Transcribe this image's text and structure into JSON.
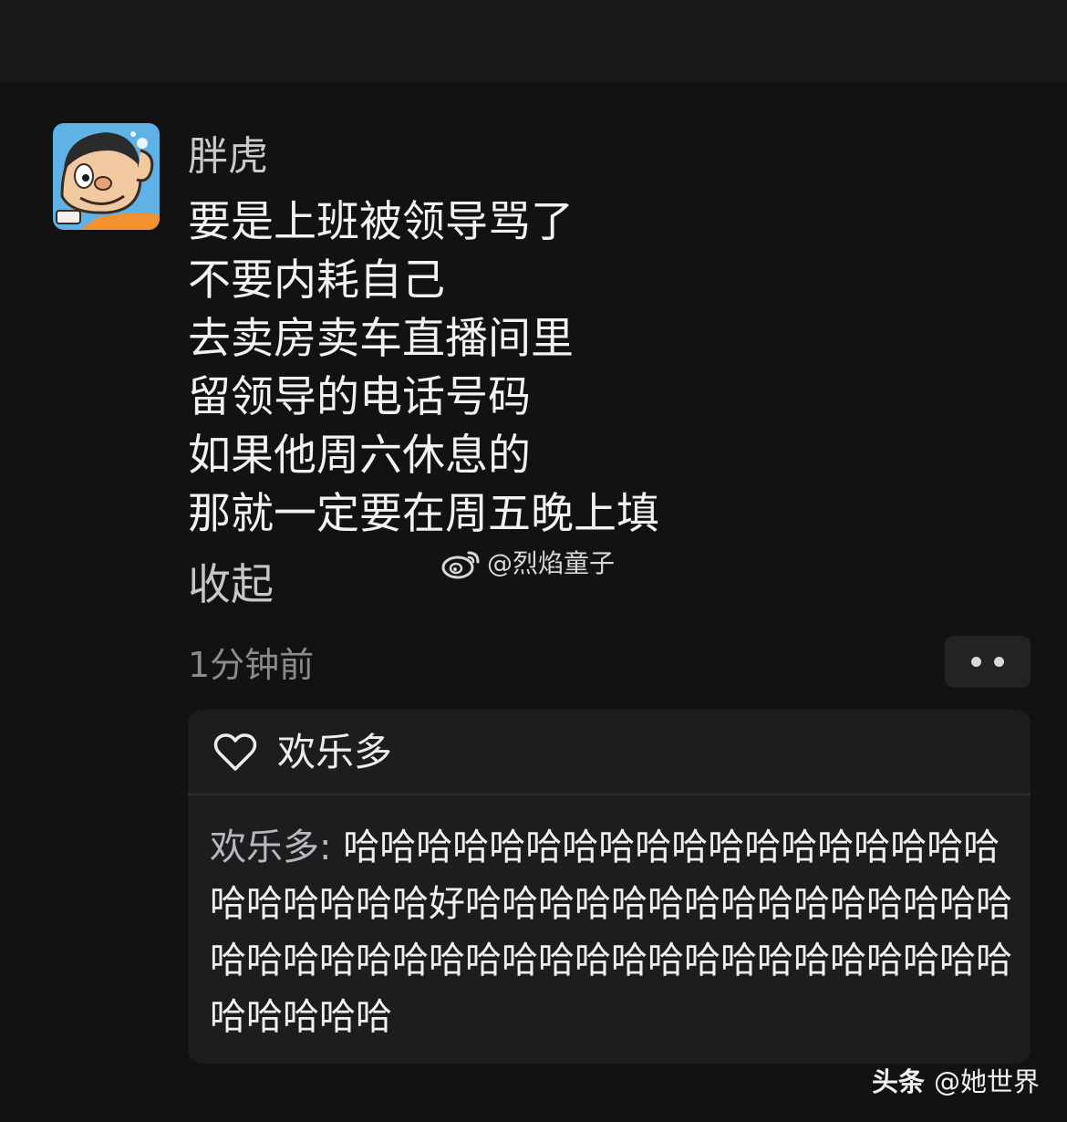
{
  "post": {
    "username": "胖虎",
    "lines": [
      "要是上班被领导骂了",
      "不要内耗自己",
      "去卖房卖车直播间里",
      "留领导的电话号码",
      "如果他周六休息的",
      "那就一定要在周五晚上填"
    ],
    "collapse_label": "收起",
    "timestamp": "1分钟前"
  },
  "reply": {
    "liker": "欢乐多",
    "author": "欢乐多:",
    "text": " 哈哈哈哈哈哈哈哈哈哈哈哈哈哈哈哈哈哈哈哈哈哈哈哈好哈哈哈哈哈哈哈哈哈哈哈哈哈哈哈哈哈哈哈哈哈哈哈哈哈哈哈哈哈哈哈哈哈哈哈哈哈哈哈哈哈哈"
  },
  "watermarks": {
    "weibo": "@烈焰童子",
    "toutiao_brand": "头条",
    "toutiao_handle": "@她世界"
  },
  "icons": {
    "avatar": "cartoon-avatar",
    "weibo": "weibo-logo-icon",
    "heart": "heart-outline-icon",
    "more": "more-dots-icon"
  },
  "colors": {
    "background": "#121213",
    "card": "#1d1d1f",
    "username": "#c9c9cc",
    "timestamp": "#8c8c90"
  }
}
